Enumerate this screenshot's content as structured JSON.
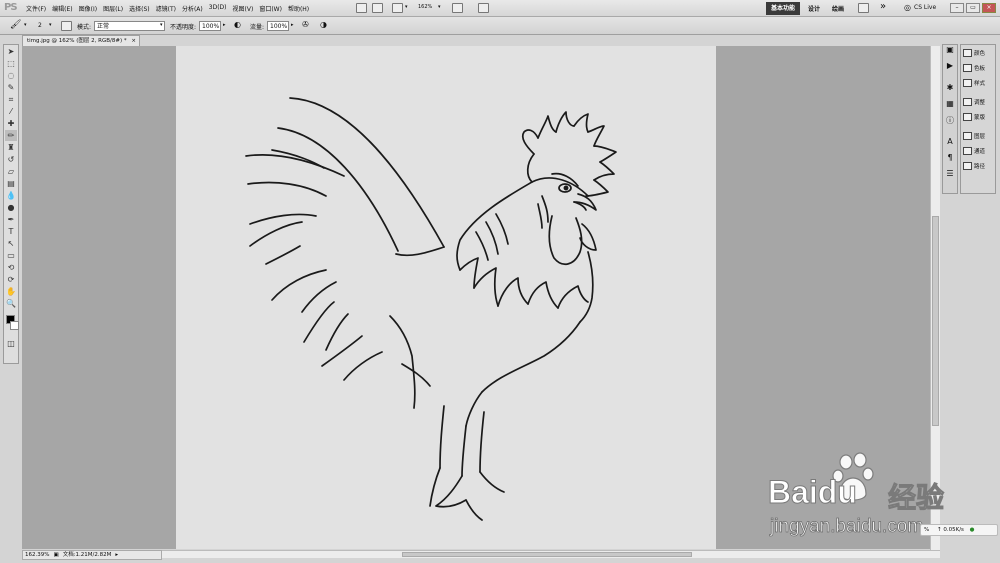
{
  "app": {
    "logo": "PS"
  },
  "menu": [
    "文件(F)",
    "编辑(E)",
    "图像(I)",
    "图层(L)",
    "选择(S)",
    "滤镜(T)",
    "分析(A)",
    "3D(D)",
    "视图(V)",
    "窗口(W)",
    "帮助(H)"
  ],
  "topbar": {
    "zoom": "162%",
    "workspaces": [
      "基本功能",
      "设计",
      "绘画"
    ],
    "more": "»",
    "cs_live": "CS Live"
  },
  "options": {
    "brush_size": "2",
    "mode_label": "模式:",
    "mode_value": "正常",
    "opacity_label": "不透明度:",
    "opacity_value": "100%",
    "flow_label": "流量:",
    "flow_value": "100%"
  },
  "document": {
    "tab_title": "timg.jpg @ 162% (图层 2, RGB/8#) *",
    "zoom_status": "162.39%",
    "doc_size": "文档:1.21M/2.82M"
  },
  "panels": {
    "groups": [
      {
        "items": [
          {
            "icon": "palette-icon",
            "label": "颜色"
          },
          {
            "icon": "swatches-icon",
            "label": "色板"
          },
          {
            "icon": "styles-icon",
            "label": "样式"
          }
        ]
      },
      {
        "items": [
          {
            "icon": "adjustments-icon",
            "label": "调整"
          },
          {
            "icon": "masks-icon",
            "label": "蒙版"
          }
        ]
      },
      {
        "items": [
          {
            "icon": "layers-icon",
            "label": "图层"
          },
          {
            "icon": "channels-icon",
            "label": "通道"
          },
          {
            "icon": "paths-icon",
            "label": "路径"
          }
        ]
      }
    ]
  },
  "watermark": {
    "brand": "Baidu",
    "brand_cn": "经验",
    "url": "jingyan.baidu.com"
  },
  "netspeed": {
    "value": "0.05K/s",
    "prefix": "%"
  },
  "colors": {
    "accent_active_workspace": "#3a3a3a",
    "canvas_bg": "#e2e2e2",
    "workspace_bg": "#a6a6a6"
  }
}
